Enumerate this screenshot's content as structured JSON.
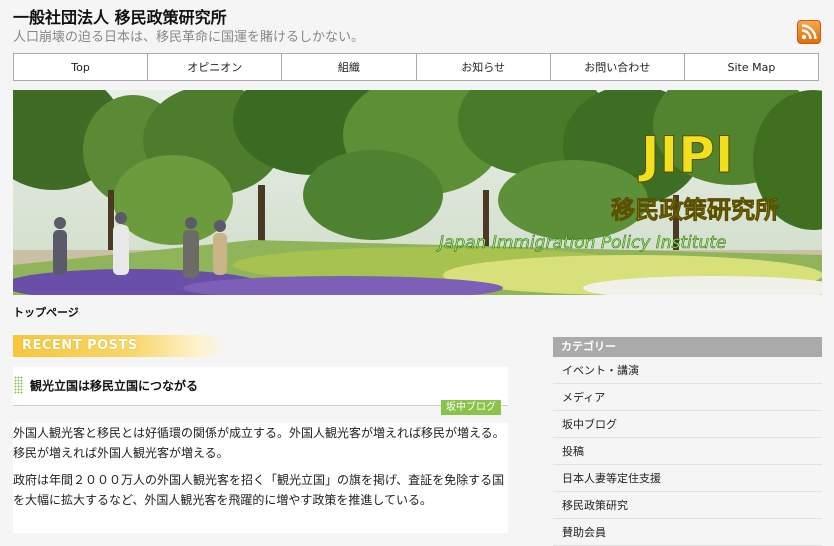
{
  "header": {
    "site_title": "一般社団法人 移民政策研究所",
    "site_description": "人口崩壊の迫る日本は、移民革命に国運を賭けるしかない。",
    "rss_icon": "rss-icon"
  },
  "nav": {
    "items": [
      {
        "label": "Top"
      },
      {
        "label": "オピニオン"
      },
      {
        "label": "組織"
      },
      {
        "label": "お知らせ"
      },
      {
        "label": "お問い合わせ"
      },
      {
        "label": "Site Map"
      }
    ]
  },
  "banner": {
    "title": "JIPI",
    "subtitle": "移民政策研究所",
    "english": "Japan Immigration Policy Institute"
  },
  "breadcrumb": "トップページ",
  "recent_posts": {
    "heading": "RECENT POSTS",
    "post": {
      "title": "観光立国は移民立国につながる",
      "category": "坂中ブログ",
      "paragraphs": [
        "外国人観光客と移民とは好循環の関係が成立する。外国人観光客が増えれば移民が増える。移民が増えれば外国人観光客が増える。",
        "政府は年間２０００万人の外国人観光客を招く「観光立国」の旗を掲げ、査証を免除する国を大幅に拡大するなど、外国人観光客を飛躍的に増やす政策を推進している。"
      ]
    }
  },
  "sidebar": {
    "heading": "カテゴリー",
    "categories": [
      "イベント・講演",
      "メディア",
      "坂中ブログ",
      "投稿",
      "日本人妻等定住支援",
      "移民政策研究",
      "賛助会員"
    ]
  },
  "colors": {
    "accent_yellow": "#f8c63a",
    "tag_green": "#8bc34a",
    "banner_text_yellow": "#f0e020",
    "sidebar_gray": "#aaaaaa"
  }
}
